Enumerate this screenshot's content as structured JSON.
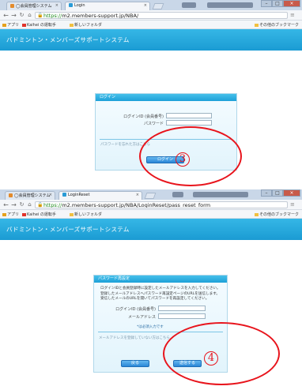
{
  "screens": [
    {
      "tabs": [
        {
          "label": "◯会員管理システム"
        },
        {
          "label": "Login",
          "active": true
        }
      ],
      "url": {
        "scheme": "https://",
        "rest": "m2.members-support.jp/NBA/"
      },
      "bookmarks": [
        {
          "label": "アプリ"
        },
        {
          "label": "Kaihei の運転手"
        },
        {
          "label": "新しいフォルダ"
        }
      ],
      "bookmarks_right": "その他のブックマーク",
      "banner_title": "バドミントン・メンバーズサポートシステム",
      "dialog": {
        "header": "ログイン",
        "id_label": "ログインID (会員番号)",
        "password_label": "パスワード",
        "forgot_link": "パスワードを忘れた方はこちら",
        "login_button": "ログイン"
      },
      "step": "3"
    },
    {
      "tabs": [
        {
          "label": "◯会員管理システム"
        },
        {
          "label": "LoginReset",
          "active": true
        }
      ],
      "url": {
        "scheme": "https://",
        "rest": "m2.members-support.jp/NBA/LoginReset/pass_reset_form"
      },
      "bookmarks": [
        {
          "label": "アプリ"
        },
        {
          "label": "Kaihei の運転手"
        },
        {
          "label": "新しいフォルダ"
        }
      ],
      "bookmarks_right": "その他のブックマーク",
      "banner_title": "バドミントン・メンバーズサポートシステム",
      "dialog": {
        "header": "パスワード再設定",
        "instructions": [
          "ログインIDと会員登録時に設定したメールアドレスを入力してください。",
          "登録したメールアドレスへパスワード再設定ページのURLを送信します。",
          "受信したメールのURLを開いてパスワードを再設定してください。"
        ],
        "id_label": "ログインID (会員番号)",
        "email_label": "メールアドレス",
        "required_note": "*は必須入力です",
        "unregistered_note": "メールアドレスを登録していない方はこちら",
        "back_button": "戻る",
        "send_button": "送信する"
      },
      "step": "4"
    }
  ]
}
